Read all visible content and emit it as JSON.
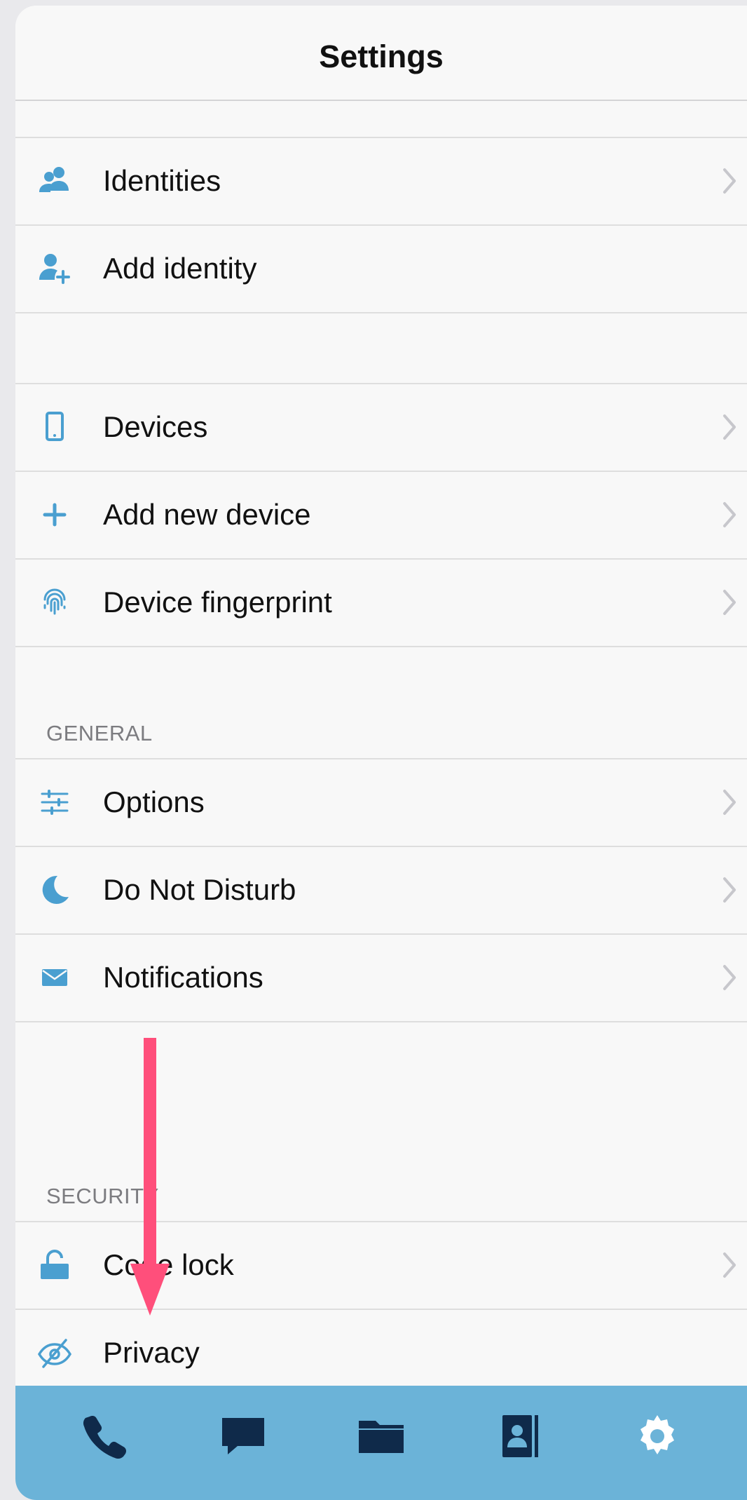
{
  "header": {
    "title": "Settings"
  },
  "colors": {
    "accent": "#4a9fd0",
    "tabbar": "#6bb3d8",
    "tab_icon": "#0f2a4a",
    "annotation_arrow": "#ff4f7b"
  },
  "groups": {
    "identity": [
      {
        "label": "Identities",
        "icon": "people-icon",
        "chevron": true
      },
      {
        "label": "Add identity",
        "icon": "add-person-icon",
        "chevron": false
      }
    ],
    "devices": [
      {
        "label": "Devices",
        "icon": "phone-icon",
        "chevron": true
      },
      {
        "label": "Add new device",
        "icon": "plus-icon",
        "chevron": true
      },
      {
        "label": "Device fingerprint",
        "icon": "fingerprint-icon",
        "chevron": true
      }
    ],
    "general_header": "GENERAL",
    "general": [
      {
        "label": "Options",
        "icon": "sliders-icon",
        "chevron": true
      },
      {
        "label": "Do Not Disturb",
        "icon": "moon-icon",
        "chevron": true
      },
      {
        "label": "Notifications",
        "icon": "envelope-icon",
        "chevron": true
      }
    ],
    "security_header": "SECURITY",
    "security": [
      {
        "label": "Code lock",
        "icon": "lock-icon",
        "chevron": true
      },
      {
        "label": "Privacy",
        "icon": "eye-slash-icon",
        "chevron": false
      }
    ]
  },
  "tabbar": [
    {
      "icon": "phone-handset-icon",
      "name": "calls"
    },
    {
      "icon": "chat-bubble-icon",
      "name": "messages"
    },
    {
      "icon": "folder-icon",
      "name": "files"
    },
    {
      "icon": "contacts-icon",
      "name": "contacts"
    },
    {
      "icon": "gear-icon",
      "name": "settings"
    }
  ]
}
